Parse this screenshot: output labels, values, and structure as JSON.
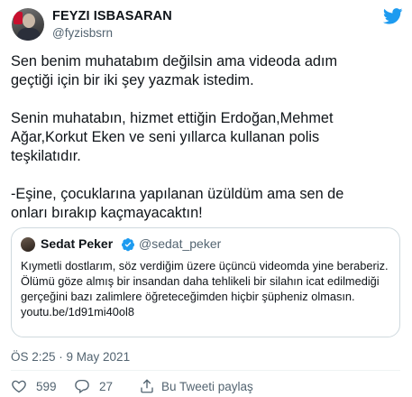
{
  "author": {
    "name": "FEYZI ISBASARAN",
    "handle": "@fyzisbsrn"
  },
  "tweet": {
    "paragraphs": [
      "Sen benim muhatabım değilsin ama videoda adım\ngeçtiği için bir iki şey yazmak istedim.",
      "Senin muhatabın, hizmet ettiğin Erdoğan,Mehmet\nAğar,Korkut Eken ve seni yıllarca kullanan polis\nteşkilatıdır.",
      "-Eşine, çocuklarına yapılanan üzüldüm ama sen de\nonları bırakıp kaçmayacaktın!"
    ]
  },
  "quoted_tweet": {
    "name": "Sedat Peker",
    "handle": "@sedat_peker",
    "text": "Kıymetli dostlarım, söz verdiğim üzere üçüncü videomda yine beraberiz. Ölümü göze almış bir insandan daha tehlikeli bir silahın icat edilmediği gerçeğini bazı zalimlere öğreteceğimden hiçbir şüpheniz olmasın. youtu.be/1d91mi40ol8"
  },
  "timestamp": "ÖS 2:25 · 9 May 2021",
  "actions": {
    "likes": "599",
    "replies": "27",
    "share_label": "Bu Tweeti paylaş"
  },
  "colors": {
    "text": "#0f1419",
    "secondary": "#536471",
    "twitter_blue": "#1d9bf0",
    "border": "#cfd9de"
  },
  "icons": [
    "twitter-bird-icon",
    "verified-badge-icon",
    "heart-icon",
    "reply-bubble-icon",
    "share-icon"
  ]
}
